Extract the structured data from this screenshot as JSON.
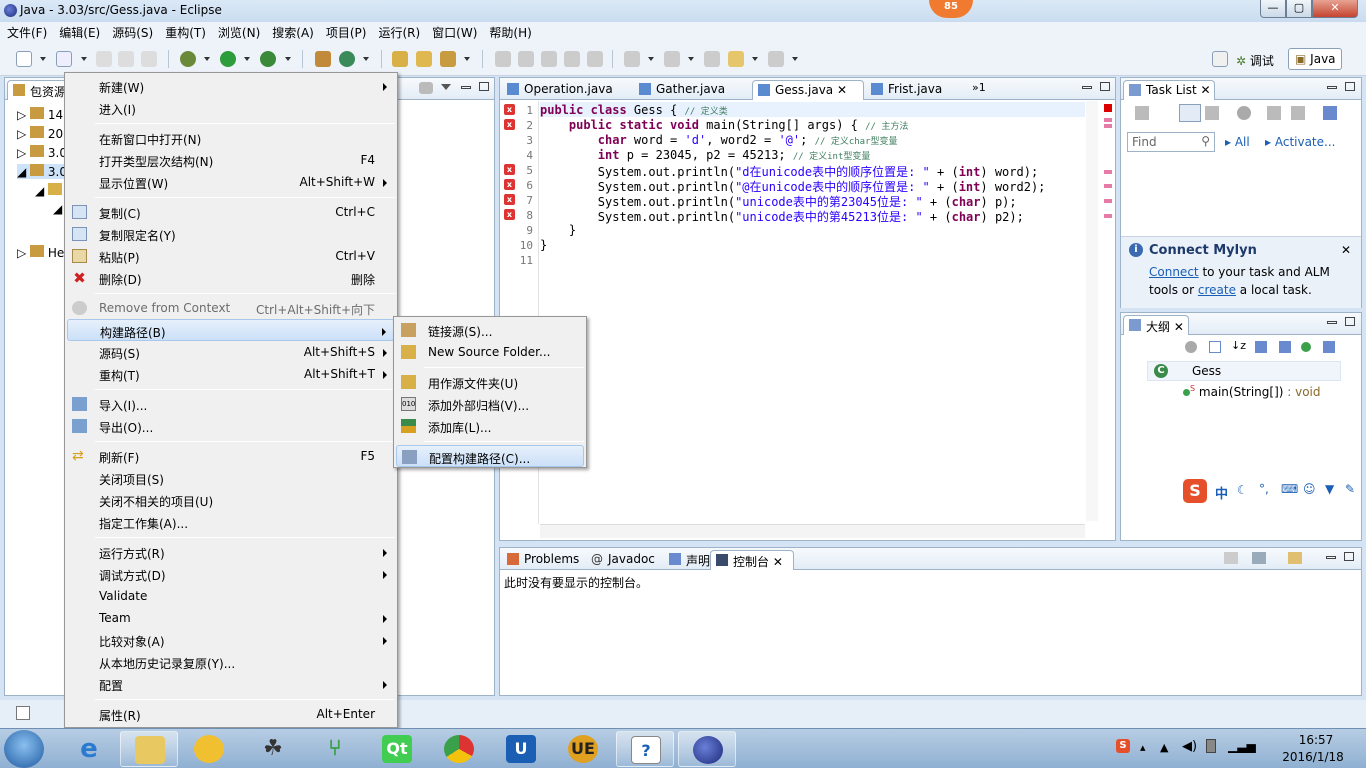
{
  "window": {
    "title": "Java - 3.03/src/Gess.java - Eclipse",
    "notify_badge": "85",
    "min": "—",
    "max": "▢",
    "close": "✕"
  },
  "menubar": [
    "文件(F)",
    "编辑(E)",
    "源码(S)",
    "重构(T)",
    "浏览(N)",
    "搜索(A)",
    "项目(P)",
    "运行(R)",
    "窗口(W)",
    "帮助(H)"
  ],
  "perspectives": {
    "debug": "调试",
    "java": "Java"
  },
  "package_explorer": {
    "tab": "包资源",
    "items": [
      "14",
      "20",
      "3.0",
      "3.0",
      "He"
    ]
  },
  "editor": {
    "tabs": [
      "Operation.java",
      "Gather.java",
      "Gess.java",
      "Frist.java"
    ],
    "overflow": "»1",
    "lines": [
      "1",
      "2",
      "3",
      "4",
      "5",
      "6",
      "7",
      "8",
      "9",
      "10",
      "11"
    ]
  },
  "context_menu": {
    "items": [
      {
        "label": "新建(W)",
        "shortcut": "",
        "sub": true
      },
      {
        "label": "进入(I)",
        "shortcut": "",
        "sub": false
      },
      {
        "label": "在新窗口中打开(N)",
        "shortcut": "",
        "sub": false
      },
      {
        "label": "打开类型层次结构(N)",
        "shortcut": "F4",
        "sub": false
      },
      {
        "label": "显示位置(W)",
        "shortcut": "Alt+Shift+W",
        "sub": true
      },
      {
        "label": "复制(C)",
        "shortcut": "Ctrl+C",
        "sub": false
      },
      {
        "label": "复制限定名(Y)",
        "shortcut": "",
        "sub": false
      },
      {
        "label": "粘贴(P)",
        "shortcut": "Ctrl+V",
        "sub": false
      },
      {
        "label": "删除(D)",
        "shortcut": "删除",
        "sub": false
      },
      {
        "label": "Remove from Context",
        "shortcut": "Ctrl+Alt+Shift+向下",
        "sub": false
      },
      {
        "label": "构建路径(B)",
        "shortcut": "",
        "sub": true
      },
      {
        "label": "源码(S)",
        "shortcut": "Alt+Shift+S",
        "sub": true
      },
      {
        "label": "重构(T)",
        "shortcut": "Alt+Shift+T",
        "sub": true
      },
      {
        "label": "导入(I)...",
        "shortcut": "",
        "sub": false
      },
      {
        "label": "导出(O)...",
        "shortcut": "",
        "sub": false
      },
      {
        "label": "刷新(F)",
        "shortcut": "F5",
        "sub": false
      },
      {
        "label": "关闭项目(S)",
        "shortcut": "",
        "sub": false
      },
      {
        "label": "关闭不相关的项目(U)",
        "shortcut": "",
        "sub": false
      },
      {
        "label": "指定工作集(A)...",
        "shortcut": "",
        "sub": false
      },
      {
        "label": "运行方式(R)",
        "shortcut": "",
        "sub": true
      },
      {
        "label": "调试方式(D)",
        "shortcut": "",
        "sub": true
      },
      {
        "label": "Validate",
        "shortcut": "",
        "sub": false
      },
      {
        "label": "Team",
        "shortcut": "",
        "sub": true
      },
      {
        "label": "比较对象(A)",
        "shortcut": "",
        "sub": true
      },
      {
        "label": "从本地历史记录复原(Y)...",
        "shortcut": "",
        "sub": false
      },
      {
        "label": "配置",
        "shortcut": "",
        "sub": true
      },
      {
        "label": "属性(R)",
        "shortcut": "Alt+Enter",
        "sub": false
      }
    ]
  },
  "build_path_menu": [
    "链接源(S)...",
    "New Source Folder...",
    "用作源文件夹(U)",
    "添加外部归档(V)...",
    "添加库(L)...",
    "配置构建路径(C)..."
  ],
  "task_list": {
    "tab": "Task List",
    "find_placeholder": "Find",
    "all": "All",
    "activate": "Activate..."
  },
  "mylyn": {
    "title": "Connect Mylyn",
    "connect": "Connect",
    "text1": " to your task and ALM",
    "text2": "tools or ",
    "create": "create",
    "text3": " a local task."
  },
  "outline": {
    "tab": "大纲",
    "class": "Gess",
    "method": "main(String[])",
    "method_type": " : void",
    "static_mark": "S"
  },
  "console": {
    "tabs": [
      "Problems",
      "Javadoc",
      "声明",
      "控制台"
    ],
    "message": "此时没有要显示的控制台。"
  },
  "ime": {
    "label": "中"
  },
  "clock": {
    "time": "16:57",
    "date": "2016/1/18"
  }
}
